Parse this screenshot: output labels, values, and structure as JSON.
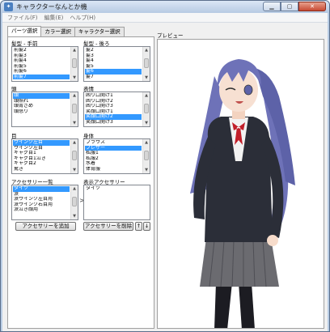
{
  "window": {
    "title": "キャラクターなんとか機"
  },
  "menu": [
    "ファイル(F)",
    "編集(E)",
    "ヘルプ(H)"
  ],
  "tabs": [
    "パーツ選択",
    "カラー選択",
    "キャラクター選択"
  ],
  "front_hair": {
    "label": "髪型 - 手前",
    "items": [
      "前髪2",
      "前髪3",
      "前髪4",
      "前髪5",
      "前髪6",
      "前髪7"
    ],
    "selected": 5
  },
  "back_hair": {
    "label": "髪型 - 後ろ",
    "items": [
      "髪2",
      "髪3",
      "髪4",
      "髪5",
      "髪6",
      "髪7"
    ],
    "selected": 4
  },
  "head": {
    "label": "頭",
    "items": [
      "頭",
      "頭照れ",
      "頭青ざめ",
      "頭怒り"
    ],
    "selected": 0
  },
  "expression": {
    "label": "表情",
    "items": [
      "困り口開け1",
      "困り口開け2",
      "困り口開け3",
      "笑顔口開け1",
      "笑顔口開け2",
      "笑顔口開け3"
    ],
    "selected": 4
  },
  "eyes": {
    "label": "目",
    "items": [
      "ウインク左目",
      "ウインク左目",
      "ギャグ目1",
      "ギャグ目1泣き",
      "ギャグ目2",
      "驚き"
    ],
    "selected": 0
  },
  "body": {
    "label": "身体",
    "items": [
      "ブラウス",
      "ブレザー",
      "私服1",
      "私服2",
      "水着",
      "体育服"
    ],
    "selected": 1
  },
  "accessory_list": {
    "label": "アクセサリー一覧",
    "items": [
      "タイツ",
      "涙",
      "涙ウインク左目用",
      "涙ウインク右目用",
      "涙泣き顔用"
    ],
    "selected": 0
  },
  "display_accessory": {
    "label": "表示アクセサリー",
    "items": [
      "タイツ"
    ]
  },
  "buttons": {
    "add": "アクセサリーを追加",
    "remove": "アクセサリーを削除",
    "up": "↑",
    "down": "↓",
    "move": ">"
  },
  "preview": {
    "label": "プレビュー"
  },
  "colors": {
    "selection": "#3399ff",
    "hair": "#6e72b8",
    "blazer": "#2b2e38",
    "skirt": "#6b6b70",
    "ribbon": "#c21f2a"
  }
}
